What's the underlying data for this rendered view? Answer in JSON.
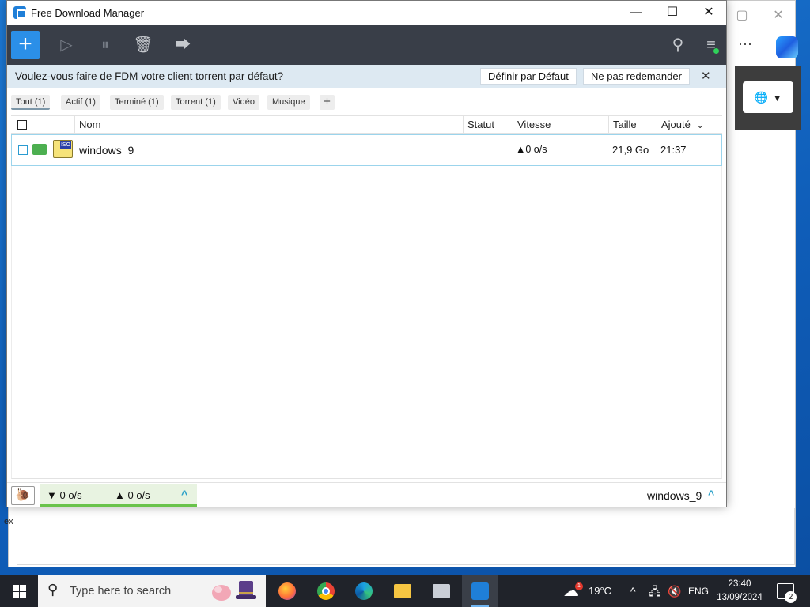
{
  "app": {
    "title": "Free Download Manager",
    "window_controls": {
      "minimize": "—",
      "maximize": "☐",
      "close": "✕"
    }
  },
  "toolbar": {
    "add_label": "+",
    "icons": [
      "play-arrow-icon",
      "pause-icon",
      "trash-icon",
      "move-folder-icon",
      "search-icon",
      "menu-icon"
    ]
  },
  "notice": {
    "text": "Voulez-vous faire de FDM votre client torrent par défaut?",
    "set_default": "Définir par Défaut",
    "dont_ask": "Ne pas redemander",
    "close": "✕"
  },
  "filters": [
    {
      "label": "Tout (1)",
      "selected": true
    },
    {
      "label": "Actif (1)",
      "selected": false
    },
    {
      "label": "Terminé (1)",
      "selected": false
    },
    {
      "label": "Torrent (1)",
      "selected": false
    },
    {
      "label": "Vidéo",
      "selected": false
    },
    {
      "label": "Musique",
      "selected": false
    }
  ],
  "filters_add": "+",
  "columns": {
    "name": "Nom",
    "status": "Statut",
    "speed": "Vitesse",
    "size": "Taille",
    "added": "Ajouté",
    "sort_indicator": "⌄"
  },
  "downloads": [
    {
      "name": "windows_9",
      "status": "",
      "speed": "▲0 o/s",
      "size": "21,9 Go",
      "added": "21:37",
      "file_tag": "ISO"
    }
  ],
  "bottom_bar": {
    "down_speed": "▼ 0 o/s",
    "up_speed": "▲ 0 o/s",
    "selected_name": "windows_9"
  },
  "taskbar": {
    "search_placeholder": "Type here to search",
    "temperature": "19°C",
    "language": "ENG",
    "time": "23:40",
    "date": "13/09/2024",
    "notification_count": "2",
    "weather_badge": "1"
  },
  "colors": {
    "accent": "#2b8fe8",
    "toolbar_bg": "#393e48",
    "notice_bg": "#dde9f2",
    "speed_panel": "#e8f3e1",
    "speed_bar": "#69c34b"
  }
}
